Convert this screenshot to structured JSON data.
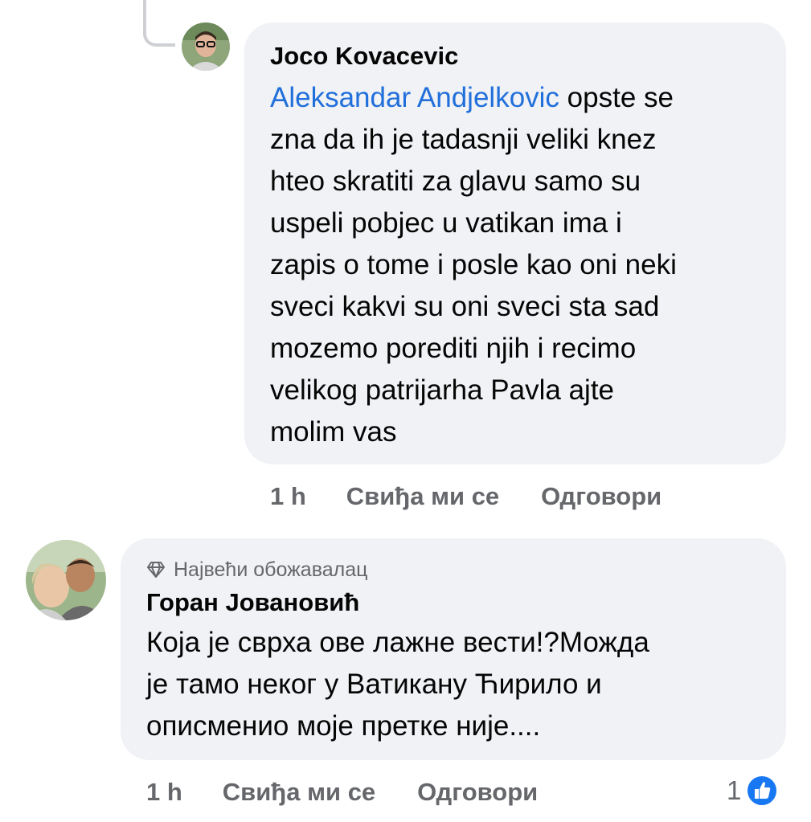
{
  "comments": [
    {
      "author": "Joco Kovacevic",
      "mention": "Aleksandar Andjelkovic",
      "lines": [
        " opste se",
        "zna da ih je tadasnji veliki knez",
        "hteo skratiti za glavu samo su",
        "uspeli pobjec u vatikan ima i",
        "zapis o tome i posle kao oni neki",
        "sveci kakvi su oni sveci sta sad",
        "mozemo porediti njih i recimo",
        "velikog patrijarha Pavla ajte",
        "molim vas"
      ],
      "time": "1 h",
      "like_label": "Свиђа ми се",
      "reply_label": "Одговори"
    },
    {
      "badge": "Највећи обожавалац",
      "author": "Горан Јовановић",
      "lines": [
        "Која је сврха ове лажне вести!?Можда",
        "је тамо неког у Ватикану Ћирило и",
        "описменио моје претке није...."
      ],
      "time": "1 h",
      "like_label": "Свиђа ми се",
      "reply_label": "Одговори",
      "reaction_count": "1",
      "reaction_icon": "like-icon"
    }
  ],
  "colors": {
    "bubble": "#f0f2f5",
    "mention": "#216fdb",
    "meta": "#65676b",
    "like_blue": "#1877f2"
  }
}
